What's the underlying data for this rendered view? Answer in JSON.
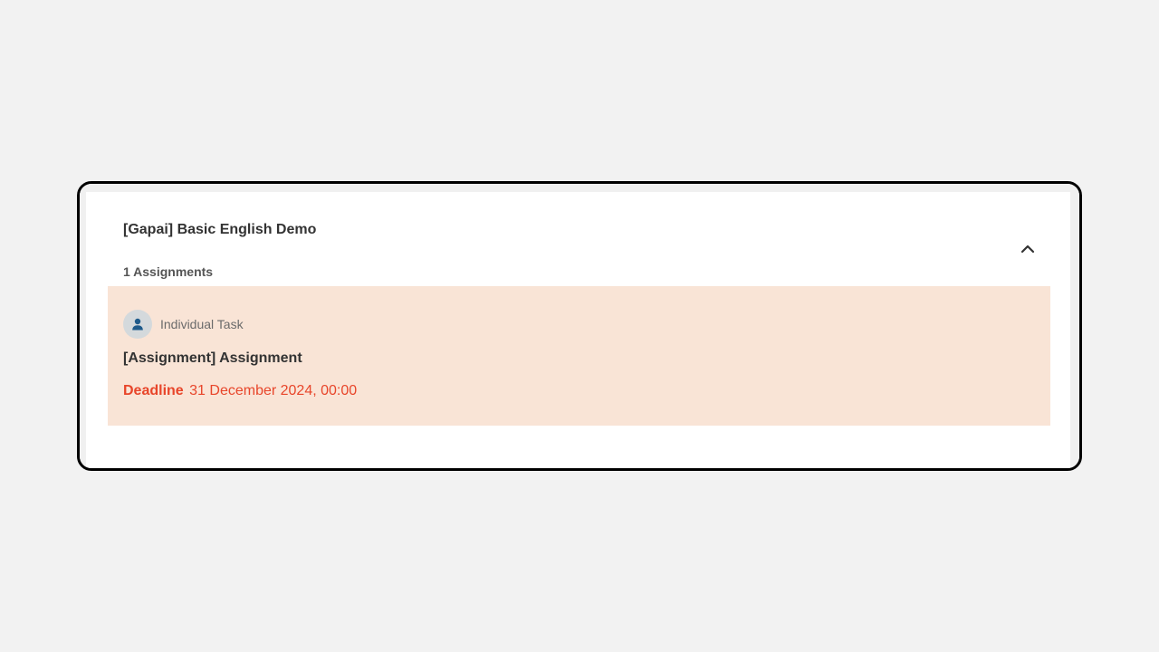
{
  "course": {
    "title": "[Gapai] Basic English Demo",
    "assignment_count": "1 Assignments",
    "collapse_icon": "chevron-up-icon"
  },
  "assignment": {
    "task_type": "Individual Task",
    "task_icon": "person-icon",
    "title": "[Assignment] Assignment",
    "deadline_label": "Deadline",
    "deadline_value": "31 December 2024, 00:00"
  },
  "colors": {
    "accent_deadline": "#e8452a",
    "card_background": "#f9e4d6",
    "avatar_background": "#d4d9dc",
    "avatar_icon": "#1e5a8a"
  }
}
